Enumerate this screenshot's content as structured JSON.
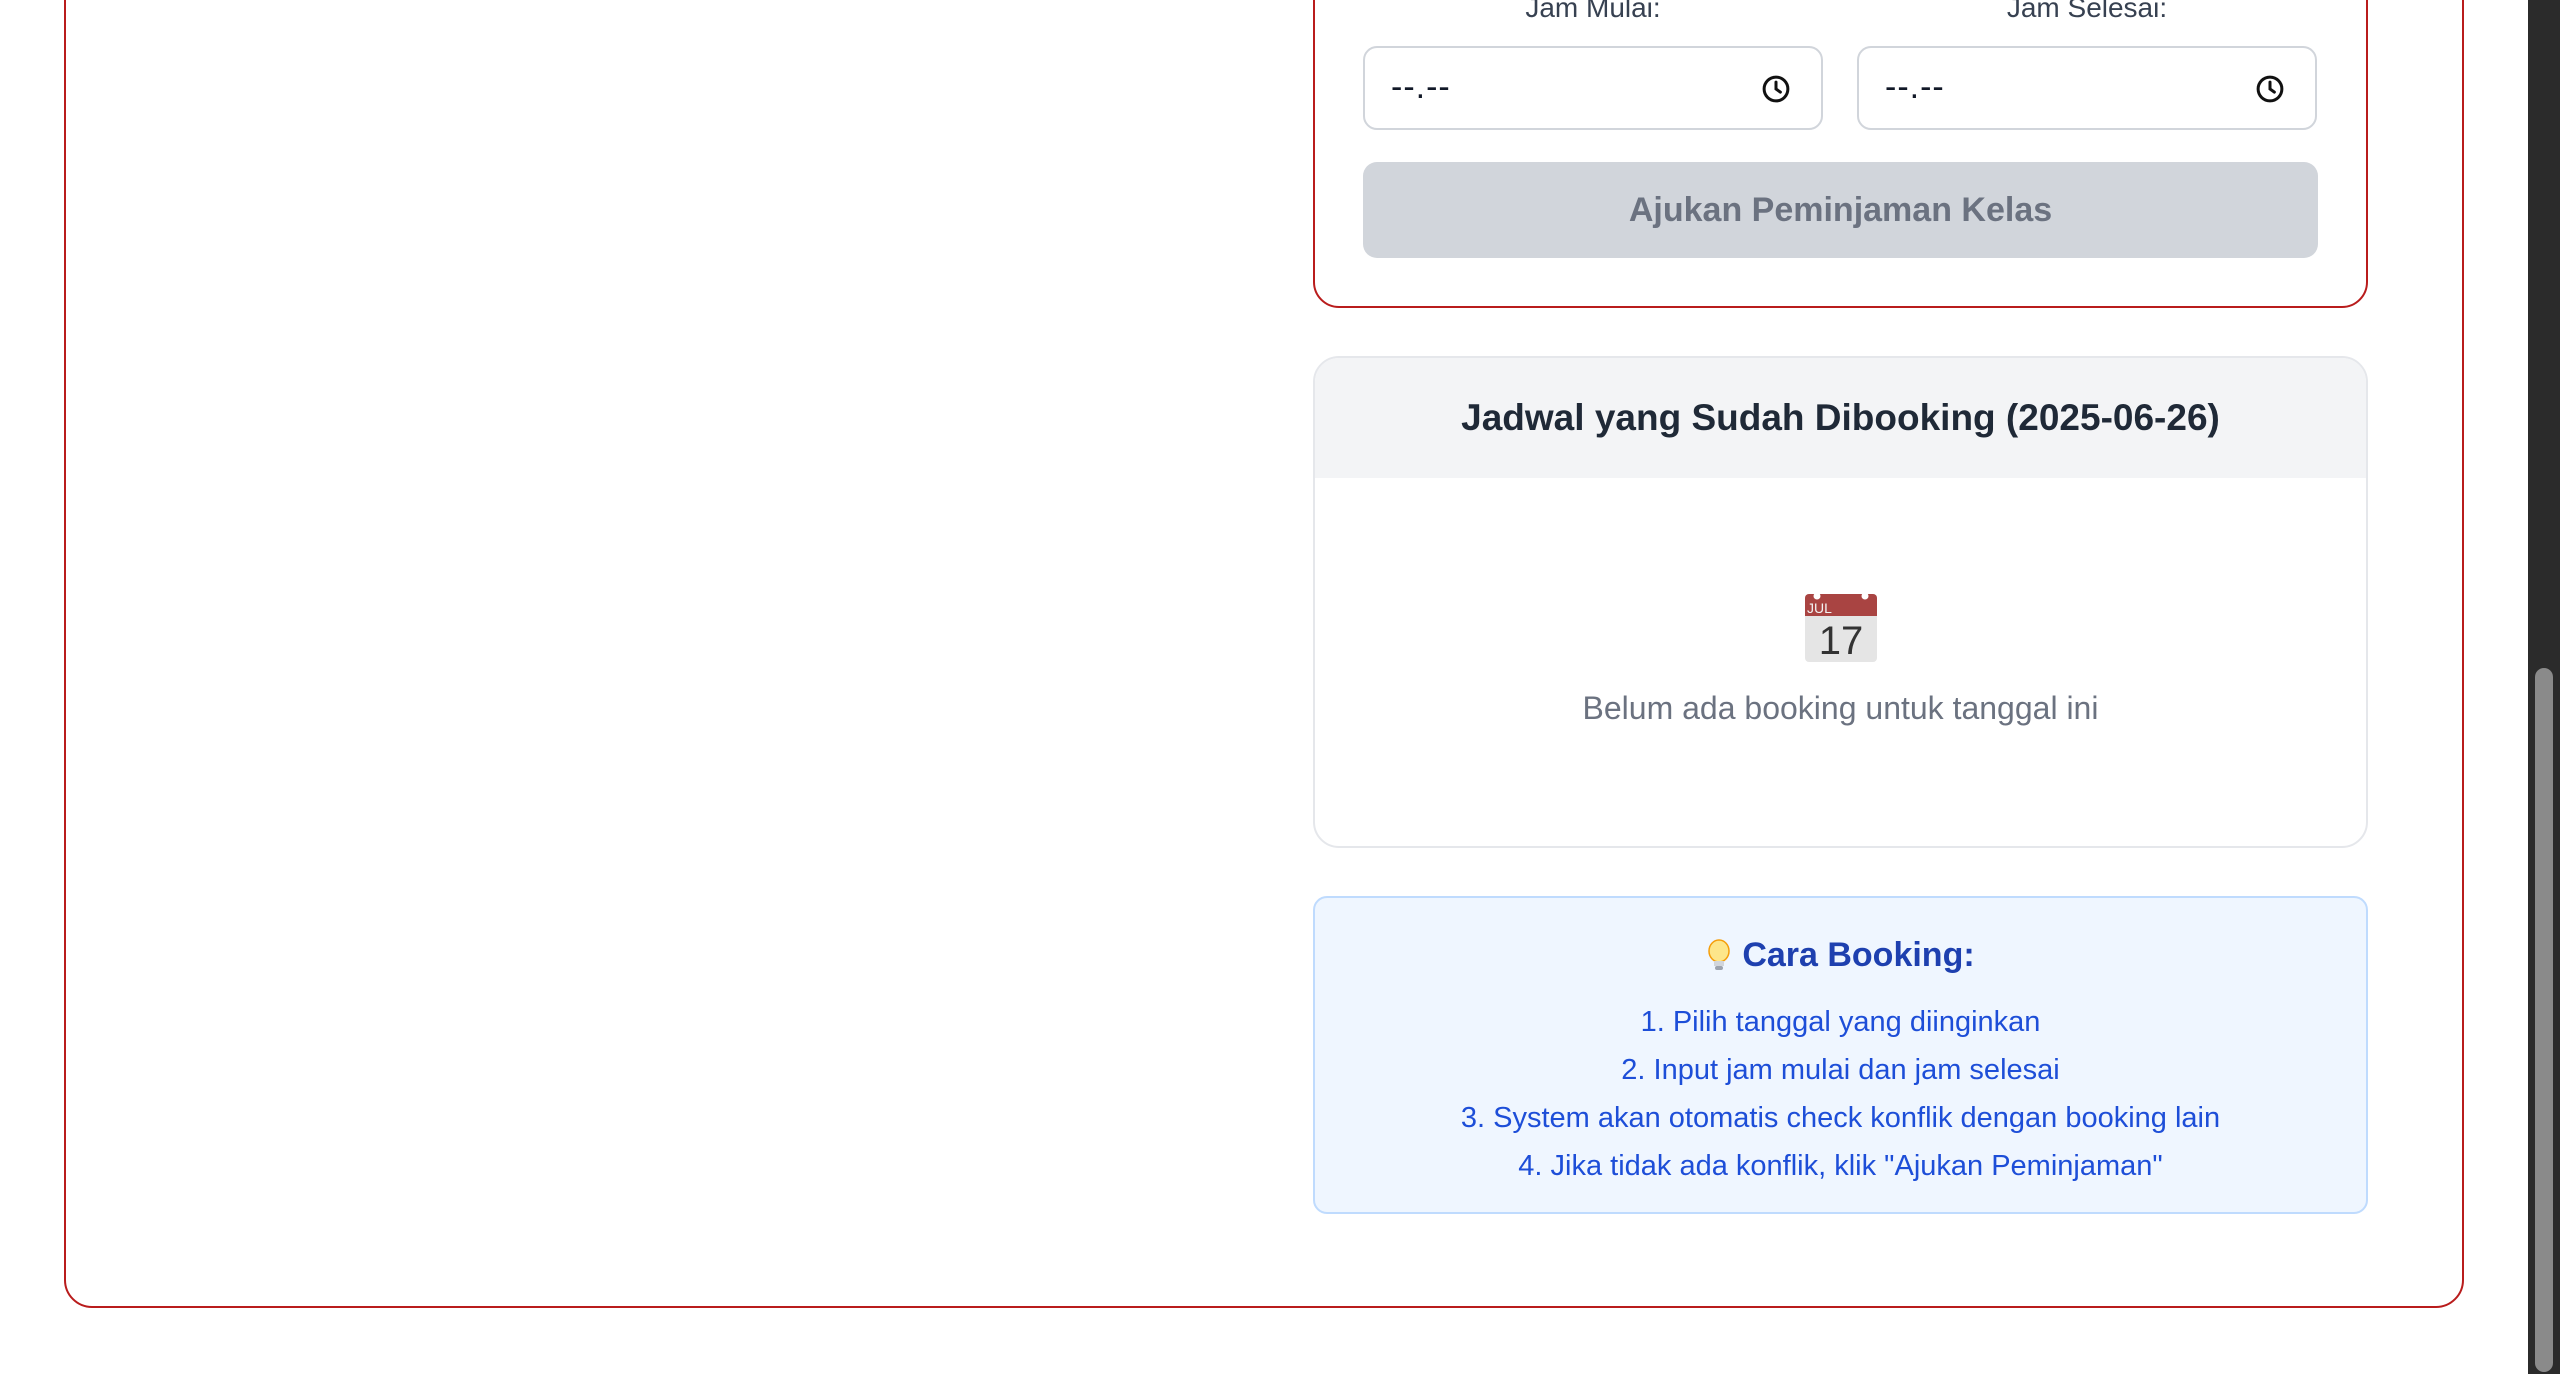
{
  "form": {
    "start_label": "Jam Mulai:",
    "end_label": "Jam Selesai:",
    "start_value": "--.--",
    "end_value": "--.--",
    "submit_label": "Ajukan Peminjaman Kelas"
  },
  "schedule": {
    "title": "Jadwal yang Sudah Dibooking (2025-06-26)",
    "calendar_icon": "calendar-icon",
    "calendar_month": "JUL",
    "calendar_day": "17",
    "empty_message": "Belum ada booking untuk tanggal ini"
  },
  "tips": {
    "icon": "lightbulb-icon",
    "title": "Cara Booking:",
    "steps": [
      "1. Pilih tanggal yang diinginkan",
      "2. Input jam mulai dan jam selesai",
      "3. System akan otomatis check konflik dengan booking lain",
      "4. Jika tidak ada konflik, klik \"Ajukan Peminjaman\""
    ]
  },
  "colors": {
    "accent_border": "#b91c1c",
    "tips_text": "#1d4ed8",
    "tips_bg": "#eff6ff",
    "disabled_button": "#d1d5db"
  }
}
